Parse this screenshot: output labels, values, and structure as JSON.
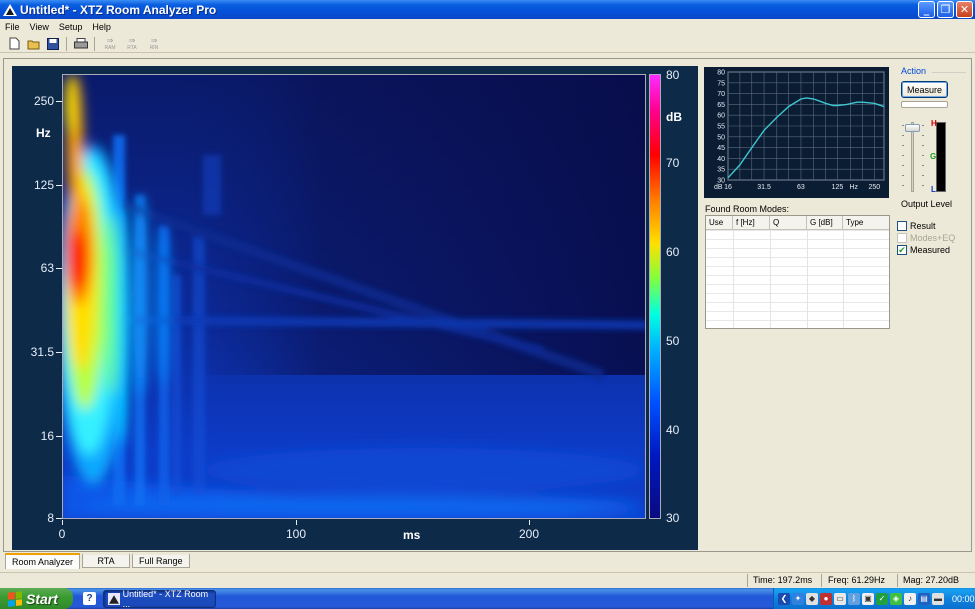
{
  "window": {
    "title": "Untitled* - XTZ Room Analyzer Pro",
    "buttons": {
      "minimize": "_",
      "restore": "❐",
      "close": "✕"
    }
  },
  "menu": [
    "File",
    "View",
    "Setup",
    "Help"
  ],
  "toolbar": {
    "icons": [
      "new-icon",
      "open-icon",
      "save-icon",
      "print-icon"
    ],
    "text_buttons": [
      "RAM",
      "RTA",
      "RIN"
    ]
  },
  "spectrogram": {
    "y_axis": {
      "unit": "Hz",
      "ticks": [
        "250",
        "125",
        "63",
        "31.5",
        "16",
        "8"
      ]
    },
    "x_axis": {
      "unit": "ms",
      "ticks": [
        "0",
        "100",
        "200"
      ]
    },
    "colorbar": {
      "unit": "dB",
      "ticks": [
        "80",
        "70",
        "60",
        "50",
        "40",
        "30"
      ]
    }
  },
  "chart_data": {
    "type": "line",
    "title": "",
    "xlabel": "Hz",
    "ylabel": "dB",
    "x_scale": "log",
    "x_ticks": [
      "16",
      "31.5",
      "63",
      "125",
      "250"
    ],
    "y_ticks": [
      "80",
      "75",
      "70",
      "65",
      "60",
      "55",
      "50",
      "45",
      "40",
      "35",
      "30"
    ],
    "ylim": [
      30,
      80
    ],
    "grid": true,
    "line_color": "#3fc6d0",
    "series": [
      {
        "x": [
          16,
          20,
          25,
          31.5,
          40,
          50,
          63,
          70,
          80,
          90,
          100,
          115,
          125,
          150,
          180,
          200,
          250,
          300
        ],
        "values": [
          31,
          37,
          45,
          53,
          59,
          64,
          67.5,
          68,
          67.5,
          66.5,
          65.5,
          64.5,
          64.5,
          65,
          66,
          66,
          65.5,
          64
        ]
      }
    ]
  },
  "room_modes": {
    "label": "Found Room Modes:",
    "columns": [
      "Use",
      "f [Hz]",
      "Q",
      "G [dB]",
      "Type"
    ],
    "rows": []
  },
  "action": {
    "legend": "Action",
    "measure_label": "Measure",
    "meter_labels": {
      "high": "H",
      "mid": "G",
      "low": "L"
    },
    "output_level_label": "Output Level"
  },
  "checkboxes": [
    {
      "label": "Result",
      "checked": false,
      "enabled": true
    },
    {
      "label": "Modes+EQ",
      "checked": false,
      "enabled": false
    },
    {
      "label": "Measured",
      "checked": true,
      "enabled": true
    }
  ],
  "tabs": [
    {
      "label": "Room Analyzer",
      "active": true
    },
    {
      "label": "RTA",
      "active": false
    },
    {
      "label": "Full Range",
      "active": false
    }
  ],
  "status": {
    "time": "Time: 197.2ms",
    "freq": "Freq: 61.29Hz",
    "mag": "Mag: 27.20dB"
  },
  "taskbar": {
    "start_label": "Start",
    "quicklaunch": "?",
    "task_label": "Untitled* - XTZ Room ...",
    "clock": "00:00"
  }
}
